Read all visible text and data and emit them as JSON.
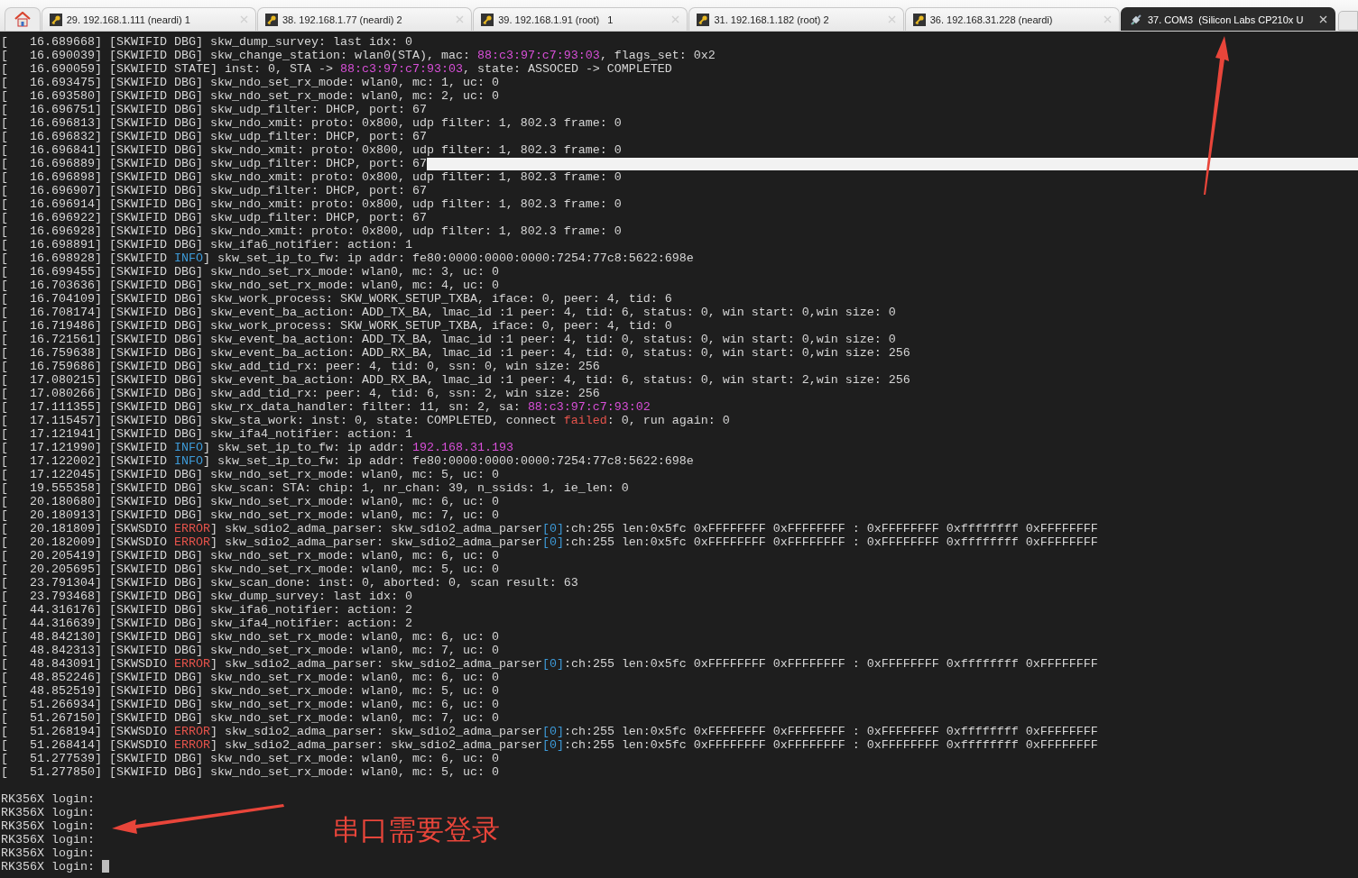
{
  "tabs": [
    {
      "label": "29. 192.168.1.111 (neardi) 1",
      "kind": "ssh",
      "selected": false
    },
    {
      "label": "38. 192.168.1.77 (neardi) 2",
      "kind": "ssh",
      "selected": false
    },
    {
      "label": "39. 192.168.1.91 (root)   1",
      "kind": "ssh",
      "selected": false
    },
    {
      "label": "31. 192.168.1.182 (root) 2",
      "kind": "ssh",
      "selected": false
    },
    {
      "label": "36. 192.168.31.228 (neardi)",
      "kind": "ssh",
      "selected": false
    },
    {
      "label": "37. COM3  (Silicon Labs CP210x U",
      "kind": "serial",
      "selected": true
    }
  ],
  "terminal": {
    "lines": [
      {
        "segments": [
          {
            "text": "[   16.689668] [SKWIFID DBG] skw_dump_survey: last idx: 0",
            "kind": "plain"
          }
        ]
      },
      {
        "segments": [
          {
            "text": "[   16.690039] [SKWIFID DBG] skw_change_station: wlan0(STA), mac: ",
            "kind": "plain"
          },
          {
            "text": "88:c3:97:c7:93:03",
            "kind": "address"
          },
          {
            "text": ", flags_set: 0x2",
            "kind": "plain"
          }
        ]
      },
      {
        "segments": [
          {
            "text": "[   16.690059] [SKWIFID STATE] inst: 0, STA -> ",
            "kind": "plain"
          },
          {
            "text": "88:c3:97:c7:93:03",
            "kind": "address"
          },
          {
            "text": ", state: ASSOCED -> COMPLETED",
            "kind": "plain"
          }
        ]
      },
      {
        "segments": [
          {
            "text": "[   16.693475] [SKWIFID DBG] skw_ndo_set_rx_mode: wlan0, mc: 1, uc: 0",
            "kind": "plain"
          }
        ]
      },
      {
        "segments": [
          {
            "text": "[   16.693580] [SKWIFID DBG] skw_ndo_set_rx_mode: wlan0, mc: 2, uc: 0",
            "kind": "plain"
          }
        ]
      },
      {
        "segments": [
          {
            "text": "[   16.696751] [SKWIFID DBG] skw_udp_filter: DHCP, port: 67",
            "kind": "plain"
          }
        ]
      },
      {
        "segments": [
          {
            "text": "[   16.696813] [SKWIFID DBG] skw_ndo_xmit: proto: 0x800, udp filter: 1, 802.3 frame: 0",
            "kind": "plain"
          }
        ]
      },
      {
        "segments": [
          {
            "text": "[   16.696832] [SKWIFID DBG] skw_udp_filter: DHCP, port: 67",
            "kind": "plain"
          }
        ]
      },
      {
        "segments": [
          {
            "text": "[   16.696841] [SKWIFID DBG] skw_ndo_xmit: proto: 0x800, udp filter: 1, 802.3 frame: 0",
            "kind": "plain"
          }
        ]
      },
      {
        "segments": [
          {
            "text": "[   16.696889] [SKWIFID DBG] skw_udp_filter: DHCP, port: 67",
            "kind": "plain"
          }
        ],
        "highlight": true
      },
      {
        "segments": [
          {
            "text": "[   16.696898] [SKWIFID DBG] skw_ndo_xmit: proto: 0x800, udp filter: 1, 802.3 frame: 0",
            "kind": "plain"
          }
        ]
      },
      {
        "segments": [
          {
            "text": "[   16.696907] [SKWIFID DBG] skw_udp_filter: DHCP, port: 67",
            "kind": "plain"
          }
        ]
      },
      {
        "segments": [
          {
            "text": "[   16.696914] [SKWIFID DBG] skw_ndo_xmit: proto: 0x800, udp filter: 1, 802.3 frame: 0",
            "kind": "plain"
          }
        ]
      },
      {
        "segments": [
          {
            "text": "[   16.696922] [SKWIFID DBG] skw_udp_filter: DHCP, port: 67",
            "kind": "plain"
          }
        ]
      },
      {
        "segments": [
          {
            "text": "[   16.696928] [SKWIFID DBG] skw_ndo_xmit: proto: 0x800, udp filter: 1, 802.3 frame: 0",
            "kind": "plain"
          }
        ]
      },
      {
        "segments": [
          {
            "text": "[   16.698891] [SKWIFID DBG] skw_ifa6_notifier: action: 1",
            "kind": "plain"
          }
        ]
      },
      {
        "segments": [
          {
            "text": "[   16.698928] [SKWIFID ",
            "kind": "plain"
          },
          {
            "text": "INFO",
            "kind": "info"
          },
          {
            "text": "] skw_set_ip_to_fw: ip addr: fe80:0000:0000:0000:7254:77c8:5622:698e",
            "kind": "plain"
          }
        ]
      },
      {
        "segments": [
          {
            "text": "[   16.699455] [SKWIFID DBG] skw_ndo_set_rx_mode: wlan0, mc: 3, uc: 0",
            "kind": "plain"
          }
        ]
      },
      {
        "segments": [
          {
            "text": "[   16.703636] [SKWIFID DBG] skw_ndo_set_rx_mode: wlan0, mc: 4, uc: 0",
            "kind": "plain"
          }
        ]
      },
      {
        "segments": [
          {
            "text": "[   16.704109] [SKWIFID DBG] skw_work_process: SKW_WORK_SETUP_TXBA, iface: 0, peer: 4, tid: 6",
            "kind": "plain"
          }
        ]
      },
      {
        "segments": [
          {
            "text": "[   16.708174] [SKWIFID DBG] skw_event_ba_action: ADD_TX_BA, lmac_id :1 peer: 4, tid: 6, status: 0, win start: 0,win size: 0",
            "kind": "plain"
          }
        ]
      },
      {
        "segments": [
          {
            "text": "[   16.719486] [SKWIFID DBG] skw_work_process: SKW_WORK_SETUP_TXBA, iface: 0, peer: 4, tid: 0",
            "kind": "plain"
          }
        ]
      },
      {
        "segments": [
          {
            "text": "[   16.721561] [SKWIFID DBG] skw_event_ba_action: ADD_TX_BA, lmac_id :1 peer: 4, tid: 0, status: 0, win start: 0,win size: 0",
            "kind": "plain"
          }
        ]
      },
      {
        "segments": [
          {
            "text": "[   16.759638] [SKWIFID DBG] skw_event_ba_action: ADD_RX_BA, lmac_id :1 peer: 4, tid: 0, status: 0, win start: 0,win size: 256",
            "kind": "plain"
          }
        ]
      },
      {
        "segments": [
          {
            "text": "[   16.759686] [SKWIFID DBG] skw_add_tid_rx: peer: 4, tid: 0, ssn: 0, win size: 256",
            "kind": "plain"
          }
        ]
      },
      {
        "segments": [
          {
            "text": "[   17.080215] [SKWIFID DBG] skw_event_ba_action: ADD_RX_BA, lmac_id :1 peer: 4, tid: 6, status: 0, win start: 2,win size: 256",
            "kind": "plain"
          }
        ]
      },
      {
        "segments": [
          {
            "text": "[   17.080266] [SKWIFID DBG] skw_add_tid_rx: peer: 4, tid: 6, ssn: 2, win size: 256",
            "kind": "plain"
          }
        ]
      },
      {
        "segments": [
          {
            "text": "[   17.111355] [SKWIFID DBG] skw_rx_data_handler: filter: 11, sn: 2, sa: ",
            "kind": "plain"
          },
          {
            "text": "88:c3:97:c7:93:02",
            "kind": "address"
          }
        ]
      },
      {
        "segments": [
          {
            "text": "[   17.115457] [SKWIFID DBG] skw_sta_work: inst: 0, state: COMPLETED, connect ",
            "kind": "plain"
          },
          {
            "text": "failed",
            "kind": "error"
          },
          {
            "text": ": 0, run again: 0",
            "kind": "plain"
          }
        ]
      },
      {
        "segments": [
          {
            "text": "[   17.121941] [SKWIFID DBG] skw_ifa4_notifier: action: 1",
            "kind": "plain"
          }
        ]
      },
      {
        "segments": [
          {
            "text": "[   17.121990] [SKWIFID ",
            "kind": "plain"
          },
          {
            "text": "INFO",
            "kind": "info"
          },
          {
            "text": "] skw_set_ip_to_fw: ip addr: ",
            "kind": "plain"
          },
          {
            "text": "192.168.31.193",
            "kind": "address"
          }
        ]
      },
      {
        "segments": [
          {
            "text": "[   17.122002] [SKWIFID ",
            "kind": "plain"
          },
          {
            "text": "INFO",
            "kind": "info"
          },
          {
            "text": "] skw_set_ip_to_fw: ip addr: fe80:0000:0000:0000:7254:77c8:5622:698e",
            "kind": "plain"
          }
        ]
      },
      {
        "segments": [
          {
            "text": "[   17.122045] [SKWIFID DBG] skw_ndo_set_rx_mode: wlan0, mc: 5, uc: 0",
            "kind": "plain"
          }
        ]
      },
      {
        "segments": [
          {
            "text": "[   19.555358] [SKWIFID DBG] skw_scan: STA: chip: 1, nr_chan: 39, n_ssids: 1, ie_len: 0",
            "kind": "plain"
          }
        ]
      },
      {
        "segments": [
          {
            "text": "[   20.180680] [SKWIFID DBG] skw_ndo_set_rx_mode: wlan0, mc: 6, uc: 0",
            "kind": "plain"
          }
        ]
      },
      {
        "segments": [
          {
            "text": "[   20.180913] [SKWIFID DBG] skw_ndo_set_rx_mode: wlan0, mc: 7, uc: 0",
            "kind": "plain"
          }
        ]
      },
      {
        "segments": [
          {
            "text": "[   20.181809] [SKWSDIO ",
            "kind": "plain"
          },
          {
            "text": "ERROR",
            "kind": "error"
          },
          {
            "text": "] skw_sdio2_adma_parser: skw_sdio2_adma_parser",
            "kind": "plain"
          },
          {
            "text": "[0]",
            "kind": "index"
          },
          {
            "text": ":ch:255 len:0x5fc 0xFFFFFFFF 0xFFFFFFFF : 0xFFFFFFFF 0xffffffff 0xFFFFFFFF",
            "kind": "plain"
          }
        ]
      },
      {
        "segments": [
          {
            "text": "[   20.182009] [SKWSDIO ",
            "kind": "plain"
          },
          {
            "text": "ERROR",
            "kind": "error"
          },
          {
            "text": "] skw_sdio2_adma_parser: skw_sdio2_adma_parser",
            "kind": "plain"
          },
          {
            "text": "[0]",
            "kind": "index"
          },
          {
            "text": ":ch:255 len:0x5fc 0xFFFFFFFF 0xFFFFFFFF : 0xFFFFFFFF 0xffffffff 0xFFFFFFFF",
            "kind": "plain"
          }
        ]
      },
      {
        "segments": [
          {
            "text": "[   20.205419] [SKWIFID DBG] skw_ndo_set_rx_mode: wlan0, mc: 6, uc: 0",
            "kind": "plain"
          }
        ]
      },
      {
        "segments": [
          {
            "text": "[   20.205695] [SKWIFID DBG] skw_ndo_set_rx_mode: wlan0, mc: 5, uc: 0",
            "kind": "plain"
          }
        ]
      },
      {
        "segments": [
          {
            "text": "[   23.791304] [SKWIFID DBG] skw_scan_done: inst: 0, aborted: 0, scan result: 63",
            "kind": "plain"
          }
        ]
      },
      {
        "segments": [
          {
            "text": "[   23.793468] [SKWIFID DBG] skw_dump_survey: last idx: 0",
            "kind": "plain"
          }
        ]
      },
      {
        "segments": [
          {
            "text": "[   44.316176] [SKWIFID DBG] skw_ifa6_notifier: action: 2",
            "kind": "plain"
          }
        ]
      },
      {
        "segments": [
          {
            "text": "[   44.316639] [SKWIFID DBG] skw_ifa4_notifier: action: 2",
            "kind": "plain"
          }
        ]
      },
      {
        "segments": [
          {
            "text": "[   48.842130] [SKWIFID DBG] skw_ndo_set_rx_mode: wlan0, mc: 6, uc: 0",
            "kind": "plain"
          }
        ]
      },
      {
        "segments": [
          {
            "text": "[   48.842313] [SKWIFID DBG] skw_ndo_set_rx_mode: wlan0, mc: 7, uc: 0",
            "kind": "plain"
          }
        ]
      },
      {
        "segments": [
          {
            "text": "[   48.843091] [SKWSDIO ",
            "kind": "plain"
          },
          {
            "text": "ERROR",
            "kind": "error"
          },
          {
            "text": "] skw_sdio2_adma_parser: skw_sdio2_adma_parser",
            "kind": "plain"
          },
          {
            "text": "[0]",
            "kind": "index"
          },
          {
            "text": ":ch:255 len:0x5fc 0xFFFFFFFF 0xFFFFFFFF : 0xFFFFFFFF 0xffffffff 0xFFFFFFFF",
            "kind": "plain"
          }
        ]
      },
      {
        "segments": [
          {
            "text": "[   48.852246] [SKWIFID DBG] skw_ndo_set_rx_mode: wlan0, mc: 6, uc: 0",
            "kind": "plain"
          }
        ]
      },
      {
        "segments": [
          {
            "text": "[   48.852519] [SKWIFID DBG] skw_ndo_set_rx_mode: wlan0, mc: 5, uc: 0",
            "kind": "plain"
          }
        ]
      },
      {
        "segments": [
          {
            "text": "[   51.266934] [SKWIFID DBG] skw_ndo_set_rx_mode: wlan0, mc: 6, uc: 0",
            "kind": "plain"
          }
        ]
      },
      {
        "segments": [
          {
            "text": "[   51.267150] [SKWIFID DBG] skw_ndo_set_rx_mode: wlan0, mc: 7, uc: 0",
            "kind": "plain"
          }
        ]
      },
      {
        "segments": [
          {
            "text": "[   51.268194] [SKWSDIO ",
            "kind": "plain"
          },
          {
            "text": "ERROR",
            "kind": "error"
          },
          {
            "text": "] skw_sdio2_adma_parser: skw_sdio2_adma_parser",
            "kind": "plain"
          },
          {
            "text": "[0]",
            "kind": "index"
          },
          {
            "text": ":ch:255 len:0x5fc 0xFFFFFFFF 0xFFFFFFFF : 0xFFFFFFFF 0xffffffff 0xFFFFFFFF",
            "kind": "plain"
          }
        ]
      },
      {
        "segments": [
          {
            "text": "[   51.268414] [SKWSDIO ",
            "kind": "plain"
          },
          {
            "text": "ERROR",
            "kind": "error"
          },
          {
            "text": "] skw_sdio2_adma_parser: skw_sdio2_adma_parser",
            "kind": "plain"
          },
          {
            "text": "[0]",
            "kind": "index"
          },
          {
            "text": ":ch:255 len:0x5fc 0xFFFFFFFF 0xFFFFFFFF : 0xFFFFFFFF 0xffffffff 0xFFFFFFFF",
            "kind": "plain"
          }
        ]
      },
      {
        "segments": [
          {
            "text": "[   51.277539] [SKWIFID DBG] skw_ndo_set_rx_mode: wlan0, mc: 6, uc: 0",
            "kind": "plain"
          }
        ]
      },
      {
        "segments": [
          {
            "text": "[   51.277850] [SKWIFID DBG] skw_ndo_set_rx_mode: wlan0, mc: 5, uc: 0",
            "kind": "plain"
          }
        ]
      }
    ],
    "login_lines": [
      {
        "text": "RK356X login:",
        "cursor": false
      },
      {
        "text": "RK356X login:",
        "cursor": false
      },
      {
        "text": "RK356X login:",
        "cursor": false
      },
      {
        "text": "RK356X login:",
        "cursor": false
      },
      {
        "text": "RK356X login:",
        "cursor": false
      },
      {
        "text": "RK356X login:",
        "cursor": true
      }
    ]
  },
  "annotation": {
    "text": "串口需要登录"
  }
}
